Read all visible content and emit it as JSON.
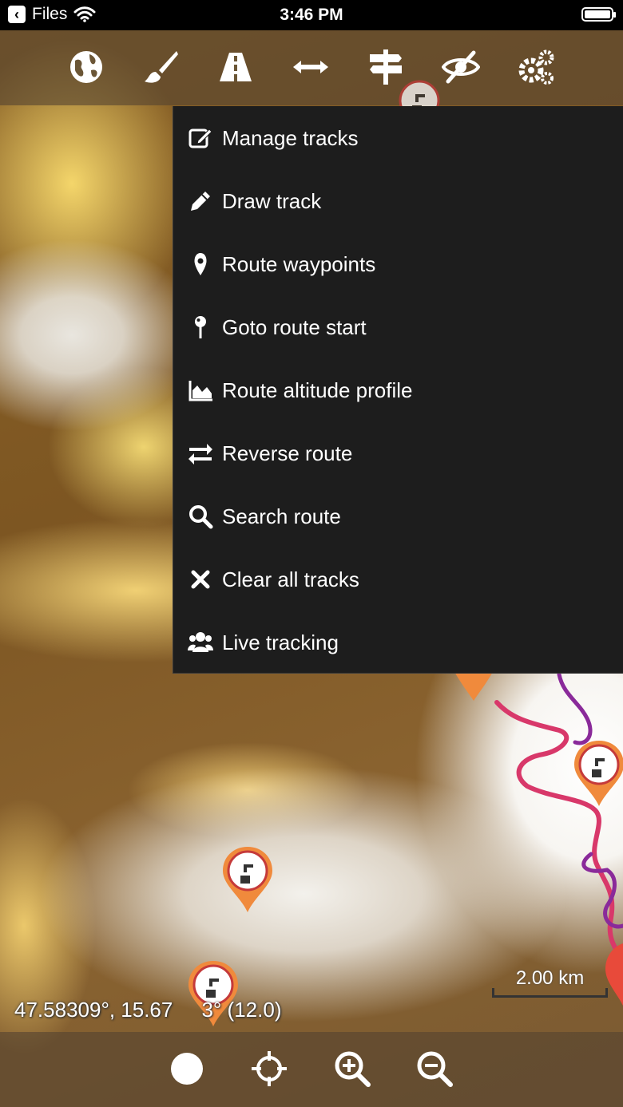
{
  "status_bar": {
    "back_app": "Files",
    "time": "3:46 PM"
  },
  "top_toolbar": {
    "icons": [
      "globe-icon",
      "brush-icon",
      "road-icon",
      "arrows-h-icon",
      "signpost-icon",
      "eye-slash-icon",
      "gears-icon"
    ]
  },
  "menu": {
    "items": [
      {
        "label": "Manage tracks",
        "icon": "edit-icon"
      },
      {
        "label": "Draw track",
        "icon": "pencil-icon"
      },
      {
        "label": "Route waypoints",
        "icon": "map-marker-icon"
      },
      {
        "label": "Goto route start",
        "icon": "pin-icon"
      },
      {
        "label": "Route altitude profile",
        "icon": "area-chart-icon"
      },
      {
        "label": "Reverse route",
        "icon": "exchange-icon"
      },
      {
        "label": "Search route",
        "icon": "search-icon"
      },
      {
        "label": "Clear all tracks",
        "icon": "times-icon"
      },
      {
        "label": "Live tracking",
        "icon": "users-icon"
      }
    ]
  },
  "map": {
    "coordinates": "47.58309°, 15.67     3° (12.0)",
    "scale": "2.00 km",
    "colors": {
      "lowland": "#7d5622",
      "highland": "#f5d880",
      "peak": "#f7f5f1",
      "route_primary": "#d8386a",
      "route_secondary": "#8a2a9a",
      "pin_fill": "#f08a3c"
    }
  },
  "bottom_toolbar": {
    "icons": [
      "circle-icon",
      "crosshairs-icon",
      "zoom-in-icon",
      "zoom-out-icon"
    ]
  }
}
